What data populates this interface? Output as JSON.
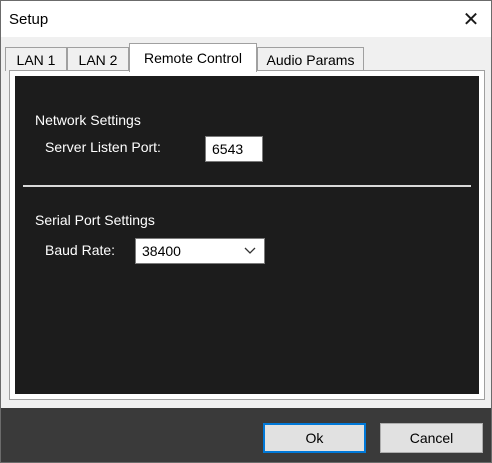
{
  "window": {
    "title": "Setup",
    "close_glyph": "✕"
  },
  "tabs": [
    {
      "label": "LAN 1",
      "active": false
    },
    {
      "label": "LAN 2",
      "active": false
    },
    {
      "label": "Remote Control",
      "active": true
    },
    {
      "label": "Audio Params",
      "active": false
    }
  ],
  "network": {
    "group_label": "Network Settings",
    "port_label": "Server Listen Port:",
    "port_value": "6543"
  },
  "serial": {
    "group_label": "Serial Port Settings",
    "baud_label": "Baud Rate:",
    "baud_value": "38400"
  },
  "buttons": {
    "ok_label": "Ok",
    "cancel_label": "Cancel"
  },
  "colors": {
    "panel_background": "#1c1c1c",
    "footer_background": "#3a3a3a",
    "default_button_border": "#0078d7"
  },
  "icons": {
    "close": "close-icon",
    "dropdown": "chevron-down-icon"
  }
}
